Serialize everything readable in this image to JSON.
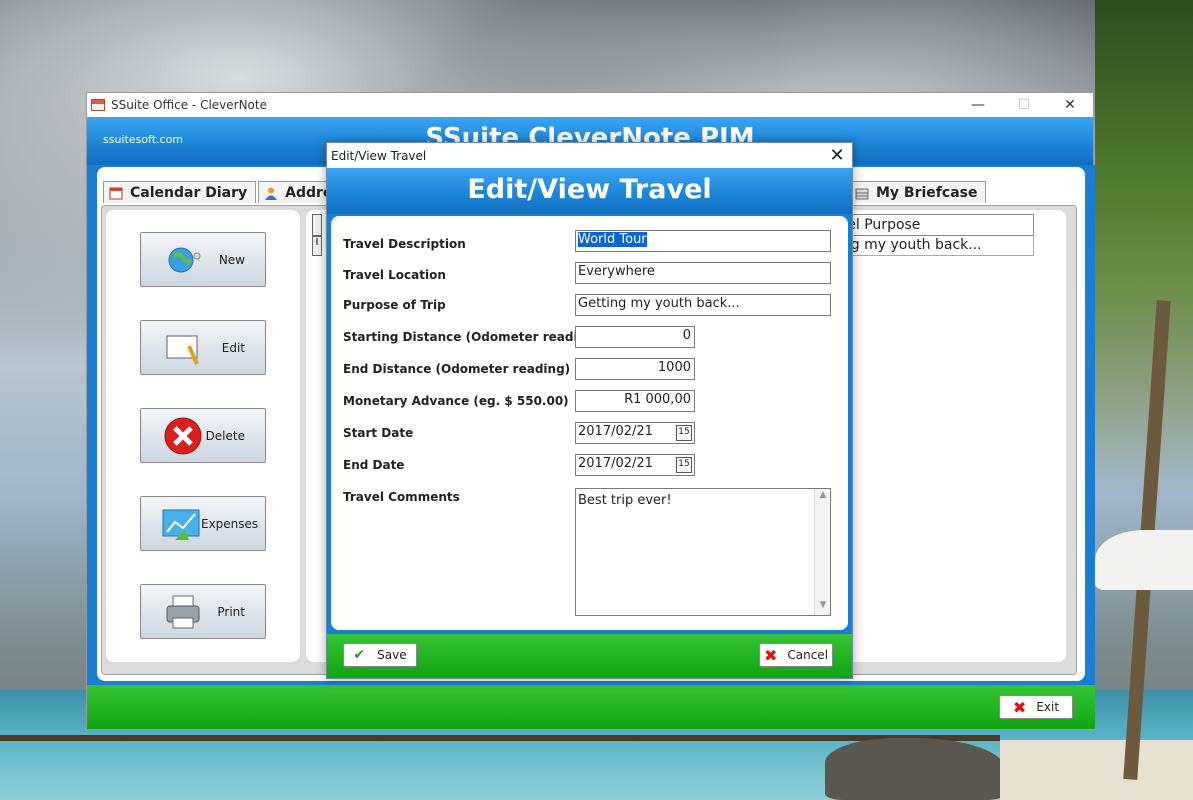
{
  "main_window": {
    "title": "SSuite Office - CleverNote",
    "controls": {
      "minimize": "—",
      "maximize": "☐",
      "close": "✕"
    },
    "banner": {
      "link": "ssuitesoft.com",
      "title": "SSuite CleverNote PIM"
    },
    "tabs": [
      {
        "label": "Calendar Diary",
        "icon": "calendar-icon"
      },
      {
        "label": "Address",
        "icon": "person-icon"
      }
    ],
    "tab_briefcase": {
      "label": "My Briefcase",
      "icon": "briefcase-icon"
    },
    "side_buttons": [
      {
        "label": "New",
        "icon": "globe-icon"
      },
      {
        "label": "Edit",
        "icon": "edit-pencil-icon"
      },
      {
        "label": "Delete",
        "icon": "delete-x-icon"
      },
      {
        "label": "Expenses",
        "icon": "chart-icon"
      },
      {
        "label": "Print",
        "icon": "printer-icon"
      }
    ],
    "grid": {
      "header_partial": "vel Purpose",
      "row_partial": "ing my youth back...",
      "row_indicator": "I"
    },
    "exit_label": "Exit"
  },
  "dialog": {
    "title": "Edit/View Travel",
    "close": "✕",
    "banner": "Edit/View Travel",
    "fields": {
      "description": {
        "label": "Travel Description",
        "value": "World Tour"
      },
      "location": {
        "label": "Travel Location",
        "value": "Everywhere"
      },
      "purpose": {
        "label": "Purpose of Trip",
        "value": "Getting my youth back..."
      },
      "start_distance": {
        "label": "Starting Distance (Odometer reading)",
        "value": "0"
      },
      "end_distance": {
        "label": "End Distance (Odometer reading)",
        "value": "1000"
      },
      "advance": {
        "label": "Monetary Advance (eg. $ 550.00)",
        "value": "R1 000,00"
      },
      "start_date": {
        "label": "Start Date",
        "value": "2017/02/21"
      },
      "end_date": {
        "label": "End Date",
        "value": "2017/02/21"
      },
      "comments": {
        "label": "Travel Comments",
        "value": "Best trip ever!"
      }
    },
    "calendar_icon_text": "15",
    "save_label": "Save",
    "cancel_label": "Cancel"
  },
  "colors": {
    "banner_blue": "#1e86d8",
    "footer_green": "#11a511",
    "selection_blue": "#0a64d8",
    "delete_red": "#d81414"
  }
}
